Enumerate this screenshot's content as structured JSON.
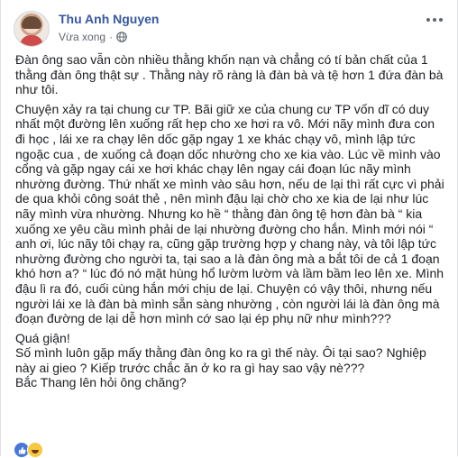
{
  "post": {
    "author": "Thu Anh Nguyen",
    "timestamp": "Vừa xong",
    "privacy_icon": "globe-icon",
    "more_icon": "more-options-icon",
    "paragraphs": [
      "Đàn ông sao vẫn còn nhiều thằng khốn nạn và chẳng có tí bản chất của 1 thằng đàn ông thật sự . Thằng này rõ ràng là đàn bà và tệ hơn 1 đứa đàn bà như tôi.",
      "Chuyện xảy ra tại chung cư TP. Bãi giữ xe của chung cư TP vốn dĩ có duy nhất một đường lên xuống rất hẹp cho xe hơi ra vô. Mới nãy mình đưa con đi học , lái xe ra chạy lên dốc gặp ngay 1 xe khác chạy vô, mình lập tức ngoặc cua , de xuống cả đoạn dốc nhường cho xe kia vào. Lúc về mình vào cổng và gặp ngay cái xe hơi khác chạy lên ngay cái đoạn lúc nãy mình nhường đường. Thứ nhất xe mình vào sâu hơn, nếu de lại thì rất cực vì phải de qua khỏi công soát thẻ , nên mình đậu lại chờ cho xe kia de lại như lúc nãy mình vừa nhường. Nhưng ko hề “ thằng đàn ông tệ hơn đàn bà “ kia xuống xe yêu cầu mình phải de lại nhường đường cho hắn. Mình mới nói “ anh ơi, lúc nãy tôi chạy ra, cũng gặp trường hợp y chang này, và tôi lập tức nhường đường cho người ta, tại sao a là đàn ông mà a bắt tôi de cả 1 đoạn khó hơn a? “ lúc đó nó mặt hùng hổ lườm lườm và lầm bầm leo lên xe. Mình đậu lì ra đó, cuối cùng hắn mới chịu de lại. Chuyện có vậy thôi, nhưng nếu người lái xe là đàn bà mình sẵn sàng nhường , còn người lái là đàn ông mà đoạn đường de lại dễ hơn mình cớ sao lại ép phụ nữ như mình???",
      "Quá giận!",
      "Số mình luôn gặp mấy thằng đàn ông ko ra gì thế này. Ôi tại sao? Nghiệp này ai gieo ? Kiếp trước chắc ăn ở ko ra gì hay sao vậy nè???",
      "Bắc Thang lên hỏi ông chăng?"
    ],
    "reaction_icons": [
      "like-reaction-icon",
      "haha-reaction-icon"
    ]
  },
  "colors": {
    "author": "#385898",
    "meta": "#606770",
    "text": "#1c1e21",
    "like": "#4a77d4",
    "haha": "#f7c844"
  }
}
